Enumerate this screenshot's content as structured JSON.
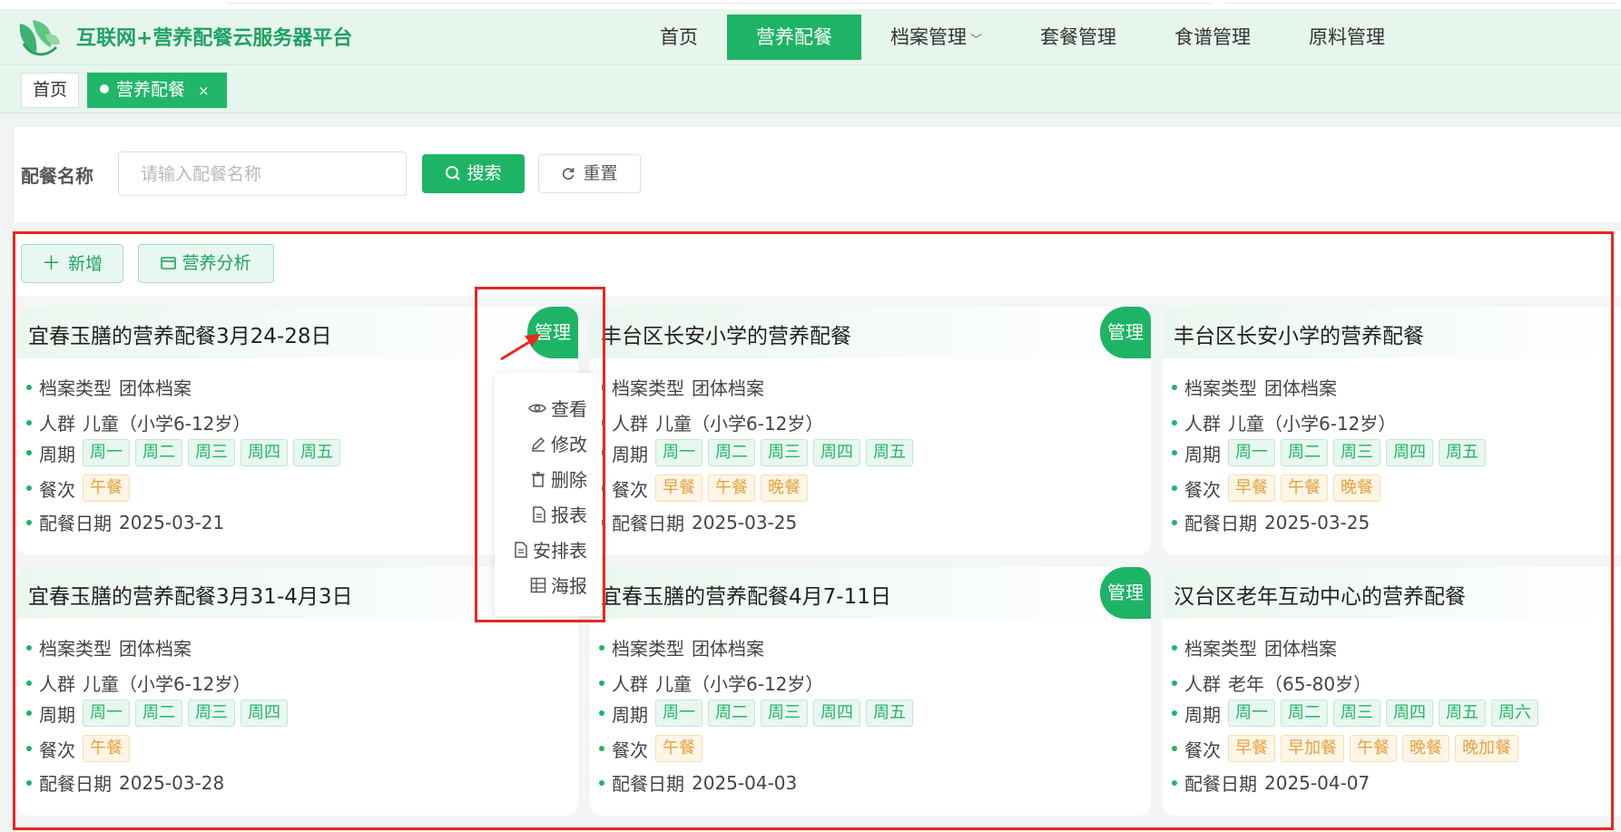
{
  "app": {
    "title": "互联网+营养配餐云服务器平台"
  },
  "nav": {
    "items": [
      {
        "label": "首页"
      },
      {
        "label": "营养配餐",
        "active": true
      },
      {
        "label": "档案管理",
        "dropdown": true
      },
      {
        "label": "套餐管理"
      },
      {
        "label": "食谱管理"
      },
      {
        "label": "原料管理"
      }
    ]
  },
  "tags": {
    "home": "首页",
    "active": "营养配餐",
    "close": "×"
  },
  "search": {
    "label": "配餐名称",
    "placeholder": "请输入配餐名称",
    "search_button": "搜索",
    "reset_button": "重置"
  },
  "toolbar": {
    "add_button": "新增",
    "analysis_button": "营养分析"
  },
  "labels": {
    "file_type": "档案类型",
    "crowd": "人群",
    "period": "周期",
    "meal": "餐次",
    "date": "配餐日期",
    "manage": "管理"
  },
  "cards": [
    {
      "title": "宜春玉膳的营养配餐3月24-28日",
      "file_type": "团体档案",
      "crowd": "儿童（小学6-12岁）",
      "days": [
        "周一",
        "周二",
        "周三",
        "周四",
        "周五"
      ],
      "meals": [
        "午餐"
      ],
      "date": "2025-03-21"
    },
    {
      "title": "丰台区长安小学的营养配餐",
      "file_type": "团体档案",
      "crowd": "儿童（小学6-12岁）",
      "days": [
        "周一",
        "周二",
        "周三",
        "周四",
        "周五"
      ],
      "meals": [
        "早餐",
        "午餐",
        "晚餐"
      ],
      "date": "2025-03-25"
    },
    {
      "title": "丰台区长安小学的营养配餐",
      "file_type": "团体档案",
      "crowd": "儿童（小学6-12岁）",
      "days": [
        "周一",
        "周二",
        "周三",
        "周四",
        "周五"
      ],
      "meals": [
        "早餐",
        "午餐",
        "晚餐"
      ],
      "date": "2025-03-25"
    },
    {
      "title": "宜春玉膳的营养配餐3月31-4月3日",
      "file_type": "团体档案",
      "crowd": "儿童（小学6-12岁）",
      "days": [
        "周一",
        "周二",
        "周三",
        "周四"
      ],
      "meals": [
        "午餐"
      ],
      "date": "2025-03-28"
    },
    {
      "title": "宜春玉膳的营养配餐4月7-11日",
      "file_type": "团体档案",
      "crowd": "儿童（小学6-12岁）",
      "days": [
        "周一",
        "周二",
        "周三",
        "周四",
        "周五"
      ],
      "meals": [
        "午餐"
      ],
      "date": "2025-04-03"
    },
    {
      "title": "汉台区老年互动中心的营养配餐",
      "file_type": "团体档案",
      "crowd": "老年（65-80岁）",
      "days": [
        "周一",
        "周二",
        "周三",
        "周四",
        "周五",
        "周六"
      ],
      "meals": [
        "早餐",
        "早加餐",
        "午餐",
        "晚餐",
        "晚加餐"
      ],
      "date": "2025-04-07"
    }
  ],
  "menu": {
    "items": [
      {
        "label": "查看",
        "icon": "eye-icon"
      },
      {
        "label": "修改",
        "icon": "edit-icon"
      },
      {
        "label": "删除",
        "icon": "trash-icon"
      },
      {
        "label": "报表",
        "icon": "document-icon"
      },
      {
        "label": "安排表",
        "icon": "document-icon"
      },
      {
        "label": "海报",
        "icon": "grid-icon"
      }
    ]
  },
  "colors": {
    "primary": "#1eb465",
    "header_bg": "#e6f6ec",
    "meal_chip": "#e6a23c",
    "annotation": "#e8281e"
  }
}
